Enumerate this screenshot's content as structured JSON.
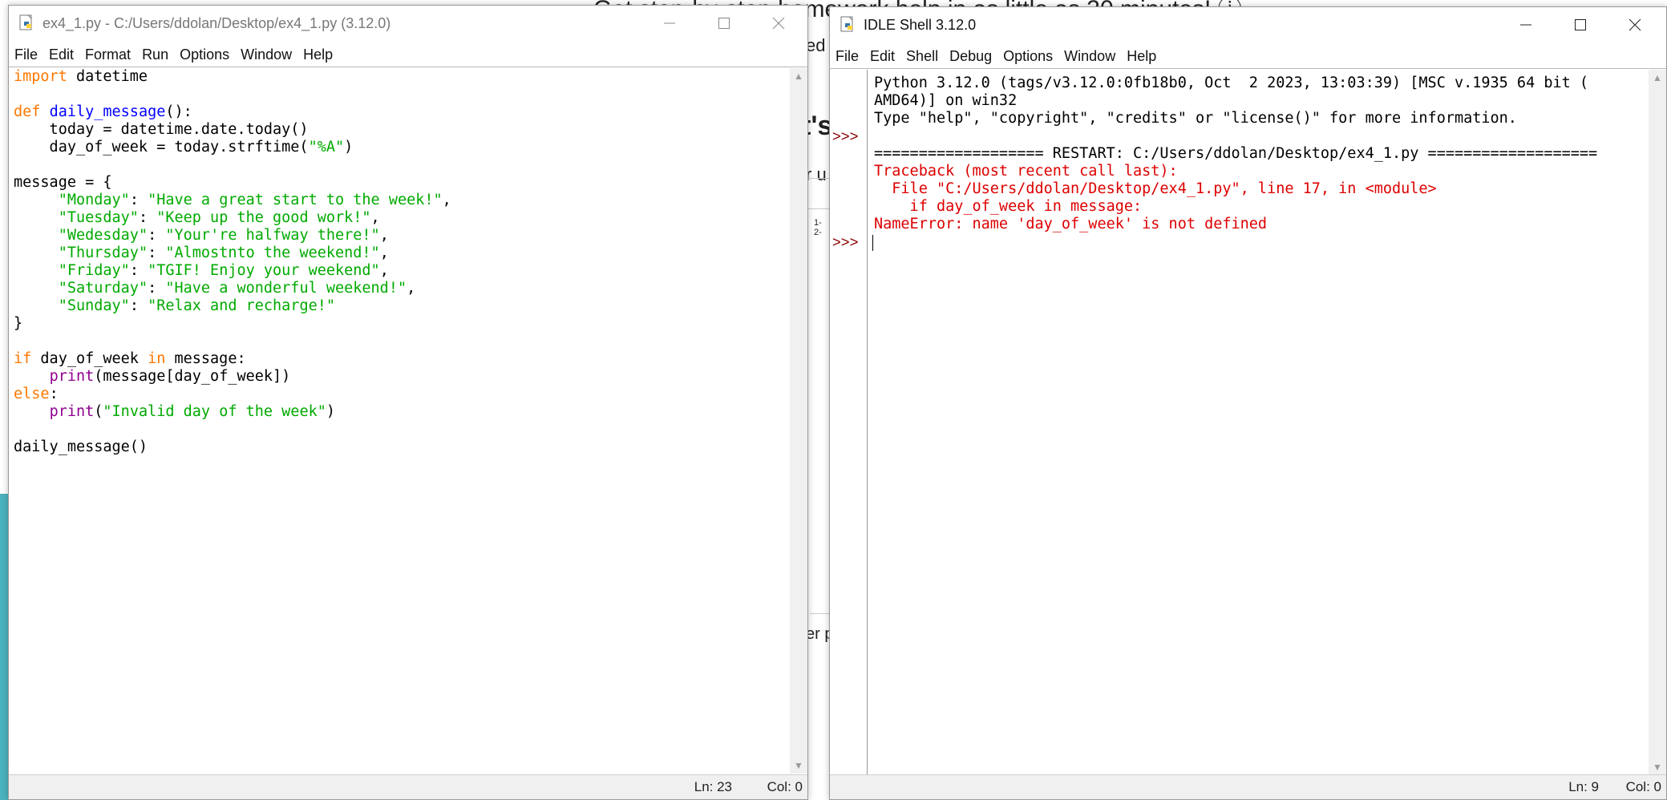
{
  "background": {
    "headline": "Get step-by-step homework help in as little as 30 minutes! ⓘ",
    "fragments": [
      "ed",
      "t's",
      "r u",
      "1-\n2-",
      "er p"
    ]
  },
  "editor_window": {
    "title": "ex4_1.py - C:/Users/ddolan/Desktop/ex4_1.py (3.12.0)",
    "menu": [
      "File",
      "Edit",
      "Format",
      "Run",
      "Options",
      "Window",
      "Help"
    ],
    "code_lines": [
      [
        {
          "t": "import",
          "c": "kw"
        },
        {
          "t": " datetime",
          "c": "plain"
        }
      ],
      [],
      [
        {
          "t": "def",
          "c": "kw"
        },
        {
          "t": " ",
          "c": "plain"
        },
        {
          "t": "daily_message",
          "c": "fn"
        },
        {
          "t": "():",
          "c": "plain"
        }
      ],
      [
        {
          "t": "    today = datetime.date.today()",
          "c": "plain"
        }
      ],
      [
        {
          "t": "    day_of_week = today.strftime(",
          "c": "plain"
        },
        {
          "t": "\"%A\"",
          "c": "str"
        },
        {
          "t": ")",
          "c": "plain"
        }
      ],
      [],
      [
        {
          "t": "message = {",
          "c": "plain"
        }
      ],
      [
        {
          "t": "     ",
          "c": "plain"
        },
        {
          "t": "\"Monday\"",
          "c": "str"
        },
        {
          "t": ": ",
          "c": "plain"
        },
        {
          "t": "\"Have a great start to the week!\"",
          "c": "str"
        },
        {
          "t": ",",
          "c": "plain"
        }
      ],
      [
        {
          "t": "     ",
          "c": "plain"
        },
        {
          "t": "\"Tuesday\"",
          "c": "str"
        },
        {
          "t": ": ",
          "c": "plain"
        },
        {
          "t": "\"Keep up the good work!\"",
          "c": "str"
        },
        {
          "t": ",",
          "c": "plain"
        }
      ],
      [
        {
          "t": "     ",
          "c": "plain"
        },
        {
          "t": "\"Wedesday\"",
          "c": "str"
        },
        {
          "t": ": ",
          "c": "plain"
        },
        {
          "t": "\"Your're halfway there!\"",
          "c": "str"
        },
        {
          "t": ",",
          "c": "plain"
        }
      ],
      [
        {
          "t": "     ",
          "c": "plain"
        },
        {
          "t": "\"Thursday\"",
          "c": "str"
        },
        {
          "t": ": ",
          "c": "plain"
        },
        {
          "t": "\"Almostnto the weekend!\"",
          "c": "str"
        },
        {
          "t": ",",
          "c": "plain"
        }
      ],
      [
        {
          "t": "     ",
          "c": "plain"
        },
        {
          "t": "\"Friday\"",
          "c": "str"
        },
        {
          "t": ": ",
          "c": "plain"
        },
        {
          "t": "\"TGIF! Enjoy your weekend\"",
          "c": "str"
        },
        {
          "t": ",",
          "c": "plain"
        }
      ],
      [
        {
          "t": "     ",
          "c": "plain"
        },
        {
          "t": "\"Saturday\"",
          "c": "str"
        },
        {
          "t": ": ",
          "c": "plain"
        },
        {
          "t": "\"Have a wonderful weekend!\"",
          "c": "str"
        },
        {
          "t": ",",
          "c": "plain"
        }
      ],
      [
        {
          "t": "     ",
          "c": "plain"
        },
        {
          "t": "\"Sunday\"",
          "c": "str"
        },
        {
          "t": ": ",
          "c": "plain"
        },
        {
          "t": "\"Relax and recharge!\"",
          "c": "str"
        }
      ],
      [
        {
          "t": "}",
          "c": "plain"
        }
      ],
      [],
      [
        {
          "t": "if",
          "c": "kw"
        },
        {
          "t": " day_of_week ",
          "c": "plain"
        },
        {
          "t": "in",
          "c": "kw"
        },
        {
          "t": " message:",
          "c": "plain"
        }
      ],
      [
        {
          "t": "    ",
          "c": "plain"
        },
        {
          "t": "print",
          "c": "bi"
        },
        {
          "t": "(message[day_of_week])",
          "c": "plain"
        }
      ],
      [
        {
          "t": "else",
          "c": "kw"
        },
        {
          "t": ":",
          "c": "plain"
        }
      ],
      [
        {
          "t": "    ",
          "c": "plain"
        },
        {
          "t": "print",
          "c": "bi"
        },
        {
          "t": "(",
          "c": "plain"
        },
        {
          "t": "\"Invalid day of the week\"",
          "c": "str"
        },
        {
          "t": ")",
          "c": "plain"
        }
      ],
      [],
      [
        {
          "t": "daily_message()",
          "c": "plain"
        }
      ]
    ],
    "status": {
      "line": "Ln: 23",
      "col": "Col: 0"
    }
  },
  "shell_window": {
    "title": "IDLE Shell 3.12.0",
    "menu": [
      "File",
      "Edit",
      "Shell",
      "Debug",
      "Options",
      "Window",
      "Help"
    ],
    "prompts": [
      ">>>",
      ">>>"
    ],
    "lines": [
      {
        "text": "Python 3.12.0 (tags/v3.12.0:0fb18b0, Oct  2 2023, 13:03:39) [MSC v.1935 64 bit (",
        "c": "plain"
      },
      {
        "text": "AMD64)] on win32",
        "c": "plain"
      },
      {
        "text": "Type \"help\", \"copyright\", \"credits\" or \"license()\" for more information.",
        "c": "plain"
      },
      {
        "text": "",
        "c": "plain"
      },
      {
        "text": "=================== RESTART: C:/Users/ddolan/Desktop/ex4_1.py ===================",
        "c": "plain"
      },
      {
        "text": "Traceback (most recent call last):",
        "c": "err"
      },
      {
        "text": "  File \"C:/Users/ddolan/Desktop/ex4_1.py\", line 17, in <module>",
        "c": "err"
      },
      {
        "text": "    if day_of_week in message:",
        "c": "err"
      },
      {
        "text": "NameError: name 'day_of_week' is not defined",
        "c": "err"
      }
    ],
    "status": {
      "line": "Ln: 9",
      "col": "Col: 0"
    }
  },
  "colors": {
    "keyword": "#ff7700",
    "function": "#0000ff",
    "string": "#00aa00",
    "builtin": "#900090",
    "error": "#dd0000"
  }
}
